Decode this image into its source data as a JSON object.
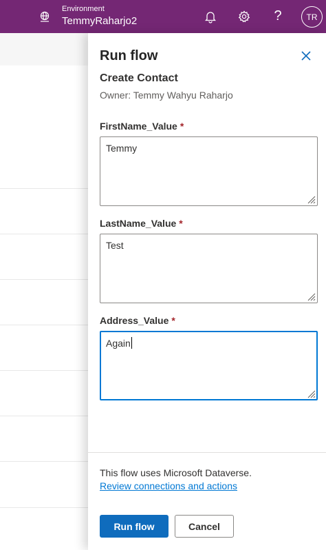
{
  "topbar": {
    "environment_label": "Environment",
    "environment_name": "TemmyRaharjo2",
    "avatar_initials": "TR",
    "help_glyph": "?",
    "color": "#742774"
  },
  "panel": {
    "title": "Run flow",
    "flow_name": "Create Contact",
    "owner": "Owner: Temmy Wahyu Raharjo",
    "fields": [
      {
        "label": "FirstName_Value",
        "required_mark": "*",
        "value": "Temmy"
      },
      {
        "label": "LastName_Value",
        "required_mark": "*",
        "value": "Test"
      },
      {
        "label": "Address_Value",
        "required_mark": "*",
        "value": "Again"
      }
    ],
    "dataverse_note": "This flow uses Microsoft Dataverse.",
    "review_link": "Review connections and actions",
    "run_button": "Run flow",
    "cancel_button": "Cancel"
  },
  "icons": {
    "environment": "globe-icon",
    "notifications": "bell-icon",
    "settings": "gear-icon",
    "help": "help-icon",
    "close": "close-icon"
  },
  "colors": {
    "accent": "#0f6cbd",
    "link": "#0078d4",
    "required": "#a4262c"
  }
}
